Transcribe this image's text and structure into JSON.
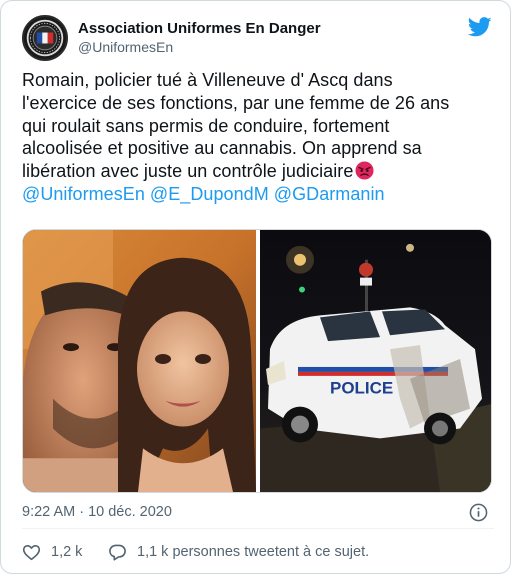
{
  "author": {
    "display_name": "Association Uniformes En Danger",
    "handle": "@UniformesEn"
  },
  "tweet": {
    "lines": [
      "Romain, policier tué à Villeneuve d' Ascq dans",
      "l'exercice de ses fonctions, par une femme de 26 ans",
      "qui roulait sans permis de conduire, fortement",
      "alcoolisée et positive au cannabis. On apprend sa",
      "libération avec juste un contrôle judiciaire"
    ],
    "emoji": "angry-face-icon",
    "mentions": [
      "@UniformesEn",
      "@E_DupondM",
      "@GDarmanin"
    ]
  },
  "media": {
    "car_text": "POLICE"
  },
  "meta": {
    "timestamp": "9:22 AM · 10 déc. 2020"
  },
  "actions": {
    "likes": "1,2 k",
    "replies": "1,1 k personnes tweetent à ce sujet."
  },
  "colors": {
    "accent": "#1d9bf0",
    "like_red": "#f91880",
    "secondary_text": "#536471"
  }
}
